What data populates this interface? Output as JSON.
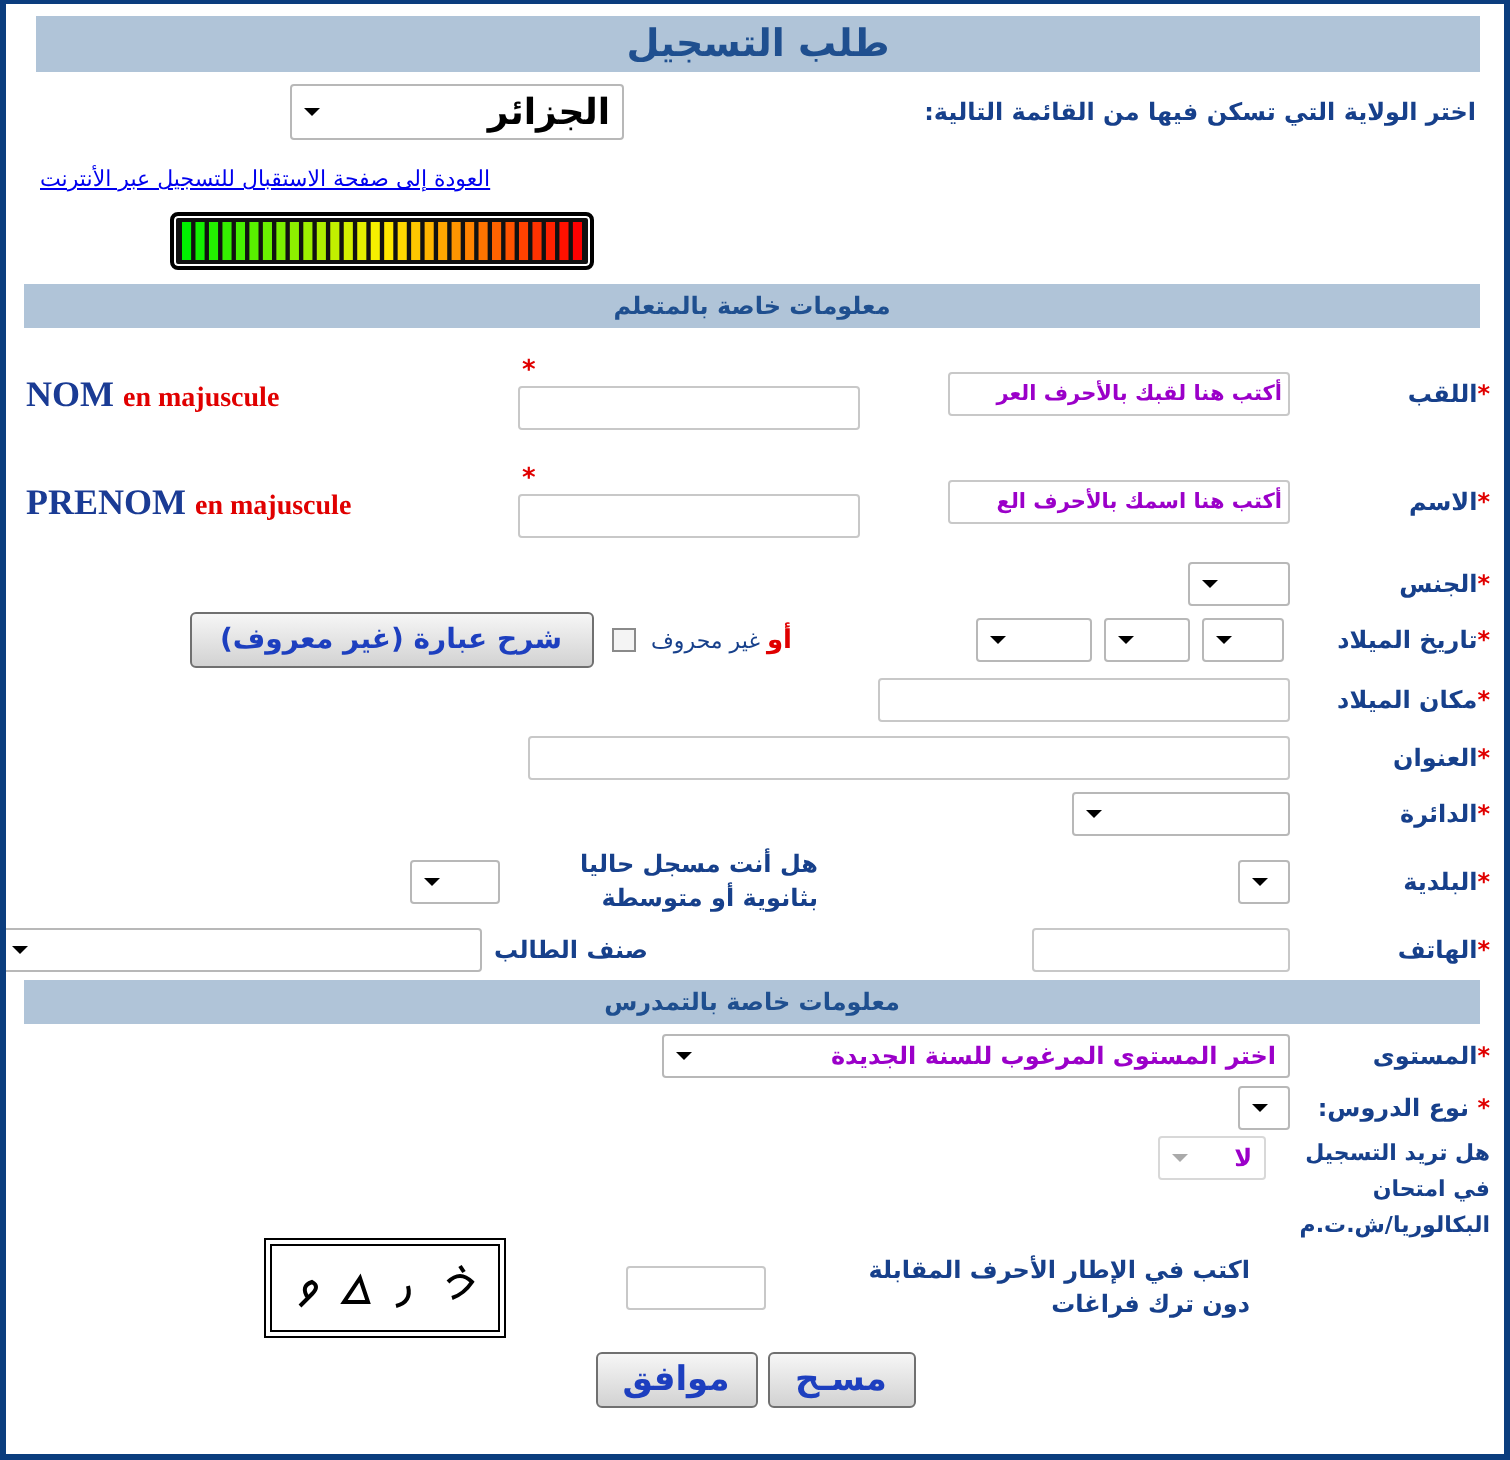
{
  "header": {
    "title": "طلب التسجيل"
  },
  "wilaya": {
    "label": "اختر الولاية التي تسكن فيها من القائمة التالية:",
    "value": "الجزائر"
  },
  "back_link": "العودة إلى صفحة الاستقبال للتسجيل عبر الأنترنت",
  "strength_meter": {
    "level": 1
  },
  "sections": [
    {
      "title": "معلومات خاصة بالمتعلم",
      "rows": [
        {
          "kind": "name",
          "mark": "*",
          "label": "اللقب",
          "value": "أكتب هنا لقبك بالأحرف العر",
          "input_mark": "*",
          "latin": "NOM",
          "note": "en majuscule"
        },
        {
          "kind": "name",
          "mark": "*",
          "label": "الاسم",
          "value": "أكتب هنا اسمك بالأحرف الع",
          "input_mark": "*",
          "latin": "PRENOM",
          "note": "en majuscule"
        },
        {
          "kind": "select",
          "mark": "*",
          "label": "الجنس"
        },
        {
          "kind": "date",
          "mark": "*",
          "label": "تاريخ الميلاد",
          "or_text": "أو",
          "unknown_label": "غير محروف",
          "checked": false,
          "button": "شرح عبارة (غير معروف)"
        },
        {
          "kind": "input",
          "mark": "*",
          "label": "مكان الميلاد"
        },
        {
          "kind": "input",
          "mark": "*",
          "label": "العنوان"
        },
        {
          "kind": "select",
          "mark": "*",
          "label": "الدائرة"
        },
        {
          "kind": "commune",
          "mark": "*",
          "label": "البلدية",
          "question": "هل أنت مسجل حاليا بثانوية أو متوسطة"
        },
        {
          "kind": "phone",
          "mark": "*",
          "label": "الهاتف",
          "category_label": "صنف الطالب"
        }
      ]
    },
    {
      "title": "معلومات خاصة بالتمدرس",
      "rows": [
        {
          "kind": "select",
          "mark": "*",
          "label": "المستوى",
          "value": "اختر المستوى المرغوب للسنة الجديدة"
        },
        {
          "kind": "select",
          "mark": "* ",
          "label": "نوع الدروس:"
        },
        {
          "kind": "bac",
          "label": "هل تريد التسجيل في امتحان البكالوريا/ش.ت.م",
          "value": "لا",
          "disabled": true
        },
        {
          "kind": "captcha",
          "instruction": "اكتب في الإطار الأحرف المقابلة دون ترك فراغات"
        }
      ]
    }
  ],
  "buttons": [
    "مسـح",
    "موافق"
  ]
}
